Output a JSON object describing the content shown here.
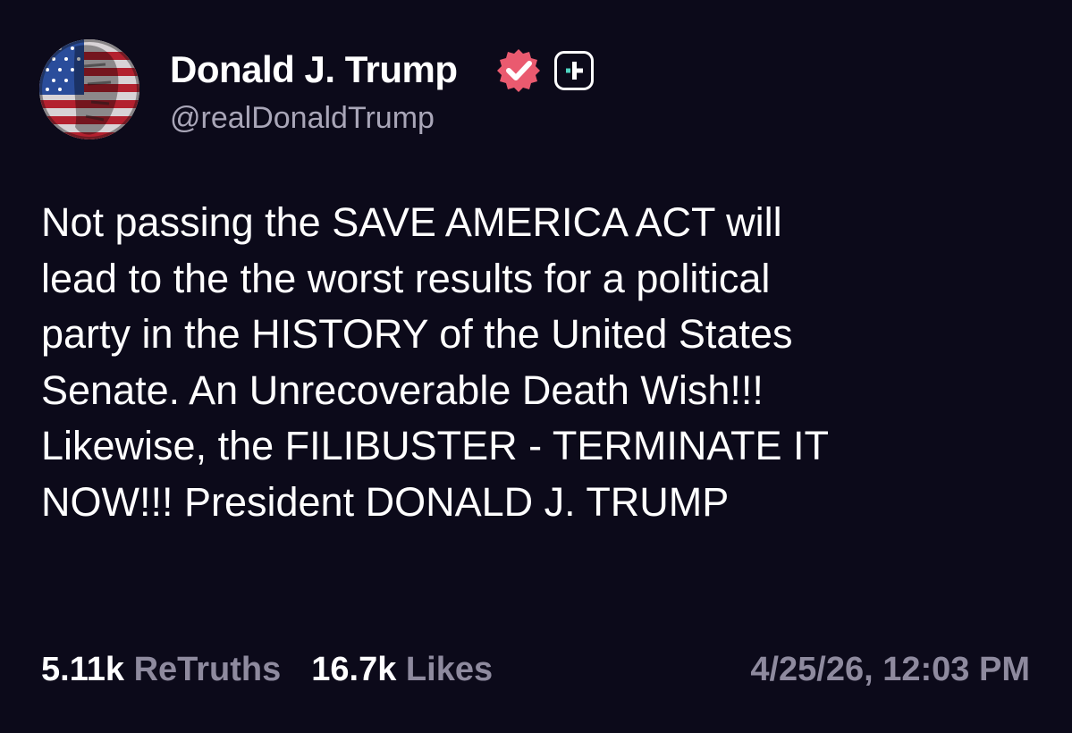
{
  "profile": {
    "display_name": "Donald J. Trump",
    "handle": "@realDonaldTrump",
    "verified": true,
    "verified_color": "#ea5a6f",
    "plus_accent_color": "#4fd6c2",
    "avatar": "flag-face-portrait"
  },
  "post": {
    "text": "Not passing the SAVE AMERICA ACT will\nlead to the the worst results for a political\nparty in the HISTORY of the United States\nSenate. An Unrecoverable Death Wish!!!\nLikewise, the FILIBUSTER - TERMINATE IT\nNOW!!! President DONALD J. TRUMP"
  },
  "stats": {
    "retruths_count": "5.11k",
    "retruths_label": "ReTruths",
    "likes_count": "16.7k",
    "likes_label": "Likes"
  },
  "timestamp": "4/25/26, 12:03 PM",
  "colors": {
    "background": "#0c0a1a",
    "primary_text": "#ffffff",
    "secondary_text": "#8e8a9e"
  }
}
